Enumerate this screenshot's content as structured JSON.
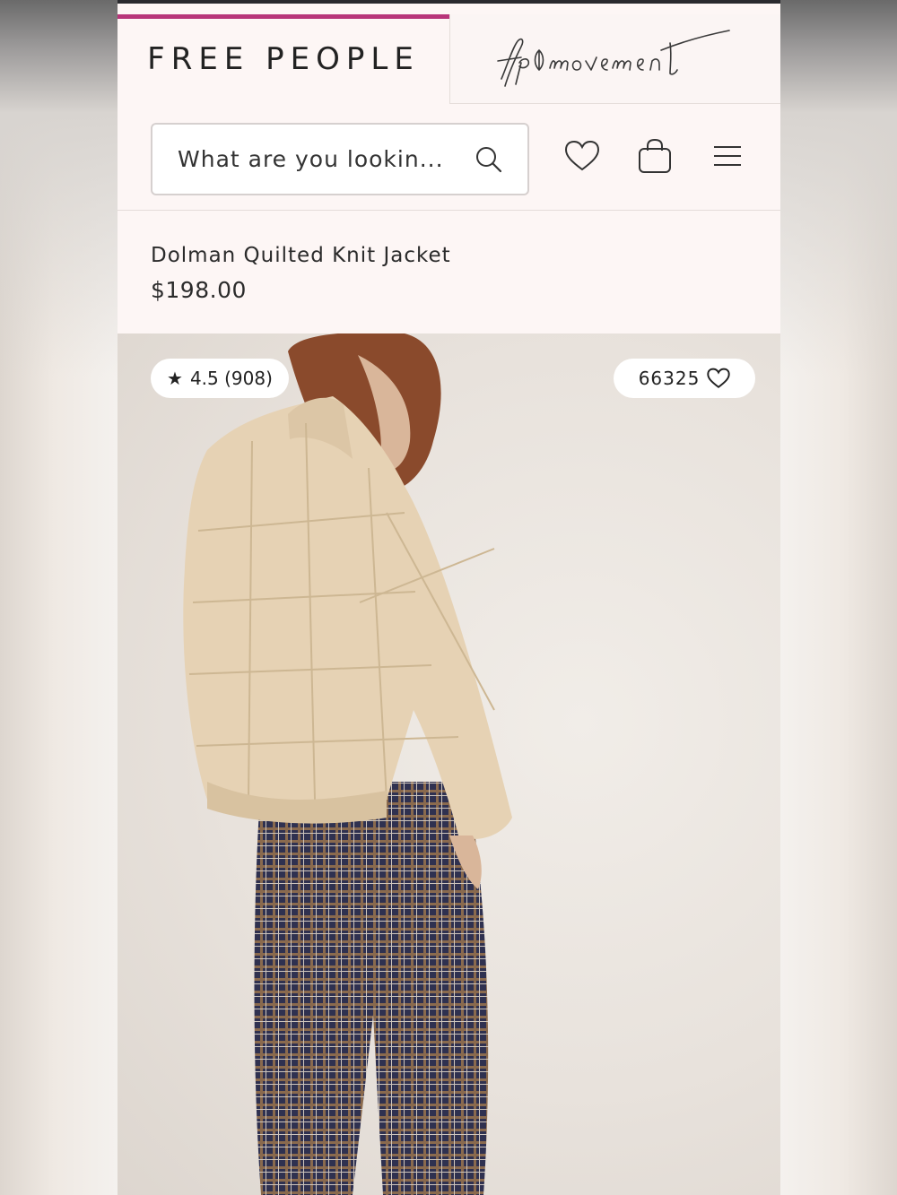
{
  "brand": {
    "primary_tab_label": "FREE PEOPLE",
    "secondary_tab_label": "fp movement",
    "accent_color": "#b8357a"
  },
  "header": {
    "search_placeholder": "What are you lookin...",
    "icons": [
      "search-icon",
      "heart-icon",
      "bag-icon",
      "hamburger-menu-icon"
    ]
  },
  "product": {
    "name": "Dolman Quilted Knit Jacket",
    "price": "$198.00",
    "rating": "4.5 (908)",
    "likes": "66325",
    "colors": {
      "jacket": "#e6d2b4",
      "pants": "#3a3c5a"
    }
  }
}
